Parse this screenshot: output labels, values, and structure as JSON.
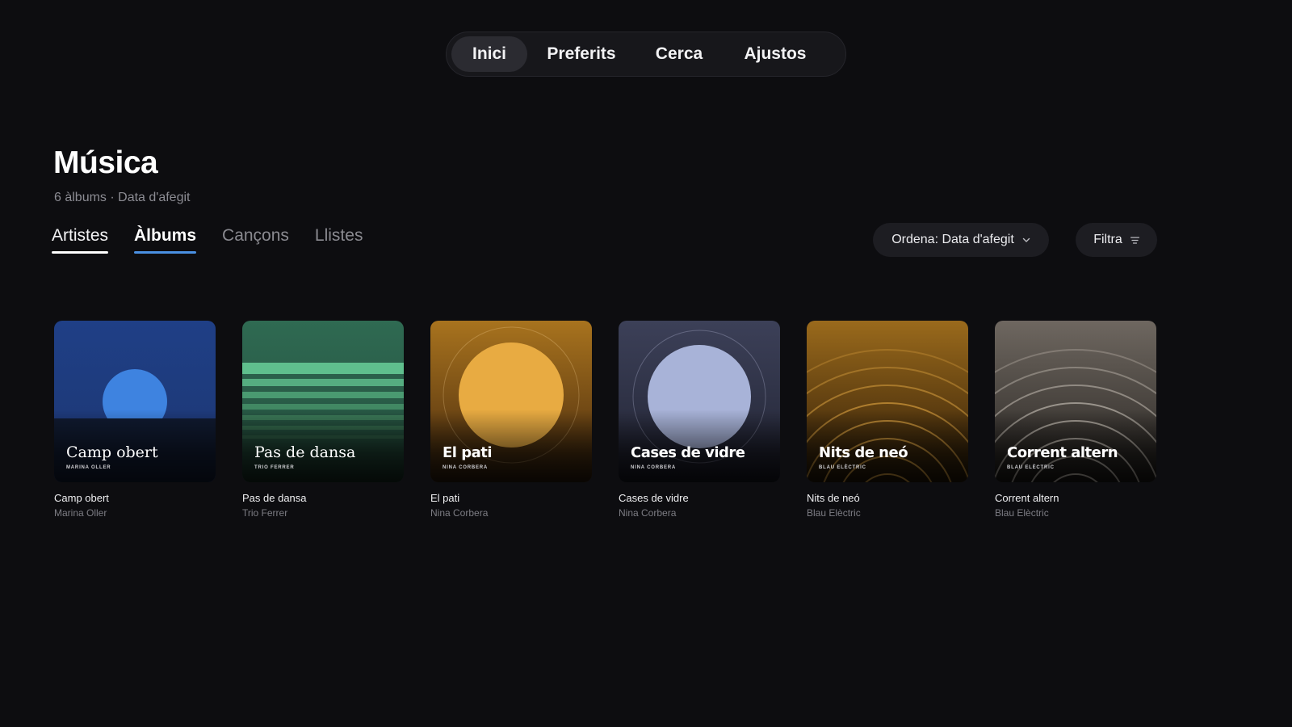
{
  "nav": {
    "items": [
      {
        "label": "Inici",
        "active": true
      },
      {
        "label": "Preferits",
        "active": false
      },
      {
        "label": "Cerca",
        "active": false
      },
      {
        "label": "Ajustos",
        "active": false
      }
    ]
  },
  "header": {
    "title": "Música",
    "subtitle": "6 àlbums · Data d'afegit"
  },
  "tabs": [
    {
      "label": "Artistes"
    },
    {
      "label": "Àlbums",
      "selected": true
    },
    {
      "label": "Cançons"
    },
    {
      "label": "Llistes"
    }
  ],
  "toolbar": {
    "sort_label": "Ordena: Data d'afegit",
    "filter_label": "Filtra"
  },
  "colors": {
    "accent": "#4a90e2",
    "background": "#0d0d10"
  },
  "albums": [
    {
      "title": "Camp obert",
      "artist": "Marina Oller",
      "cover_artist": "MARINA OLLER"
    },
    {
      "title": "Pas de dansa",
      "artist": "Trio Ferrer",
      "cover_artist": "TRIO FERRER"
    },
    {
      "title": "El pati",
      "artist": "Nina Corbera",
      "cover_artist": "NINA CORBERA"
    },
    {
      "title": "Cases de vidre",
      "artist": "Nina Corbera",
      "cover_artist": "NINA CORBERA"
    },
    {
      "title": "Nits de neó",
      "artist": "Blau Elèctric",
      "cover_artist": "BLAU ELÈCTRIC"
    },
    {
      "title": "Corrent altern",
      "artist": "Blau Elèctric",
      "cover_artist": "BLAU ELÈCTRIC"
    }
  ]
}
